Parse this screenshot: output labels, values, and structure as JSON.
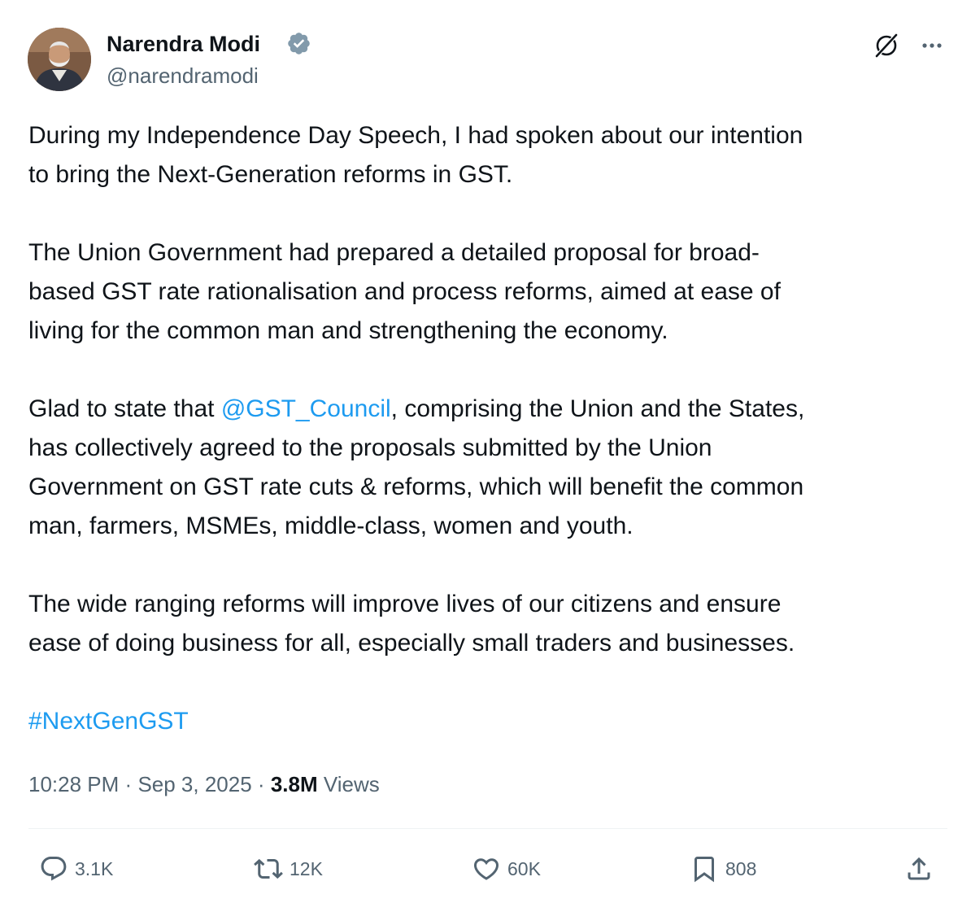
{
  "author": {
    "name": "Narendra Modi",
    "handle": "@narendramodi",
    "verified": true
  },
  "tweet": {
    "paragraphs": [
      "During my Independence Day Speech, I had spoken about our intention\nto bring the Next-Generation reforms in GST.",
      "The Union Government had prepared a detailed proposal for broad-\nbased GST rate rationalisation and process reforms, aimed at ease of\nliving for the common man and strengthening the economy.",
      "The wide ranging reforms will improve lives of our citizens and ensure\nease of doing business for all, especially small traders and businesses."
    ],
    "para3": {
      "before": "Glad to state that ",
      "mention": "@GST_Council",
      "after": ", comprising the Union and the States,\nhas collectively agreed to the proposals submitted by the Union\nGovernment on GST rate cuts & reforms, which will benefit the common\nman, farmers, MSMEs, middle-class, women and youth."
    },
    "hashtag": "#NextGenGST"
  },
  "meta": {
    "time": "10:28 PM",
    "separator": "·",
    "date": "Sep 3, 2025",
    "views_count": "3.8M",
    "views_label": "Views"
  },
  "actions": {
    "replies": "3.1K",
    "reposts": "12K",
    "likes": "60K",
    "bookmarks": "808"
  },
  "icons": [
    "verified-badge-icon",
    "grok-icon",
    "more-icon",
    "reply-icon",
    "repost-icon",
    "like-icon",
    "bookmark-icon",
    "share-icon"
  ],
  "colors": {
    "link": "#1d9bf0",
    "secondary_text": "#536471",
    "primary_text": "#0f1419",
    "verified_badge": "#829aab"
  }
}
